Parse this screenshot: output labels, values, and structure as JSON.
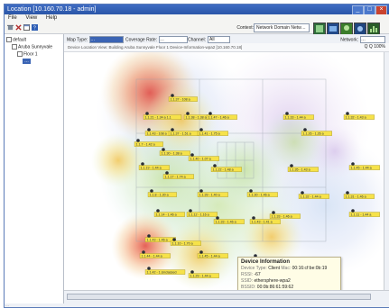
{
  "window": {
    "title": "Location [10.160.70.18 - admin]",
    "controls": [
      "_",
      "□",
      "×"
    ]
  },
  "menu": [
    "File",
    "View",
    "Help"
  ],
  "toolbar": {
    "context_label": "Context:",
    "context_value": "Network Domain Netw…",
    "icons": [
      "delete-icon",
      "refresh-icon",
      "help-icon"
    ],
    "right_icons": [
      "topology-icon",
      "map-icon",
      "users-icon",
      "settings-icon",
      "chart-icon"
    ]
  },
  "tree": {
    "items": [
      {
        "label": "default",
        "level": 0
      },
      {
        "label": "Aruba Sunnyvale",
        "level": 1
      },
      {
        "label": "Floor 1",
        "level": 2
      },
      {
        "label": "…",
        "level": 3,
        "selected": true
      }
    ]
  },
  "options": {
    "map_type_label": "Map Type:",
    "map_type_value": "…",
    "coverage_label": "Coverage Rate:",
    "coverage_value": "…",
    "channel_label": "Channel:",
    "channel_value": "All",
    "network_label": "Network:",
    "network_value": "…"
  },
  "breadcrumb": "Device Location View: Building Aruba Sunnyvale Floor 1 Device-Information-wpa2 [10.160.70.18]",
  "zoom": "Q Q 100%",
  "status": "…",
  "popup": {
    "title": "Device Information",
    "device_type_label": "Device Type:",
    "device_type_value": "Client",
    "mac_label": "Mac:",
    "mac_value": "00:16:cf:be:0b:19",
    "rssi_label": "RSSI:",
    "rssi_value": "-67",
    "ssid_label": "SSID:",
    "ssid_value": "ethersphere-wpa2",
    "bssid_label": "BSSID:",
    "bssid_value": "00:0b:86:61:59:62"
  },
  "devices": [
    {
      "label": "1.1.37 - 108 a"
    },
    {
      "label": "1.1.21 - 1.34 a 1.1"
    },
    {
      "label": "1.1.38 - 1.38 a"
    },
    {
      "label": "1.1.47 - 1.46 a"
    },
    {
      "label": "1.1.33 - 1.44 a"
    },
    {
      "label": "1.1.32 - 1.43 a"
    },
    {
      "label": "1.1.43 - 108 a"
    },
    {
      "label": "1.1.37 - 1.51 a"
    },
    {
      "label": "1.1.41 - 1.75 a"
    },
    {
      "label": "1.1.26 - 1.26 a"
    },
    {
      "label": "1.1.7 - 1.42 a"
    },
    {
      "label": "1.1.30 - 1.38 a"
    },
    {
      "label": "1.1.40 - 1.07 a"
    },
    {
      "label": "1.1.19 - 1.44 a"
    },
    {
      "label": "1.1.17 - 1.74 a"
    },
    {
      "label": "1.1.22 - 1.48 a"
    },
    {
      "label": "1.1.35 - 1.43 a"
    },
    {
      "label": "1.1.45 - 1.44 a"
    },
    {
      "label": "1.1.8 - 1.30 a"
    },
    {
      "label": "1.1.39 - 1.40 a"
    },
    {
      "label": "1.1.30 - 1.46 a"
    },
    {
      "label": "1.1.32 - 1.44 a"
    },
    {
      "label": "1.1.31 - 1.46 a"
    },
    {
      "label": "1.1.14 - 1.46 a"
    },
    {
      "label": "1.1.12 - 1.16 a"
    },
    {
      "label": "1.1.33 - 1.46 a"
    },
    {
      "label": "1.1.43 - 1.41 a"
    },
    {
      "label": "1.1.33 - 1.46 a"
    },
    {
      "label": "1.1.11 - 1.44 a"
    },
    {
      "label": "1.1.43 - 1.46 a"
    },
    {
      "label": "1.1.10 - 1.70 a"
    },
    {
      "label": "1.1.44 - 1.44 a"
    },
    {
      "label": "1.1.45 - 1.44 a"
    },
    {
      "label": "1.1.17 - 1.14 a"
    },
    {
      "label": "1.1.42 - 1.Unclassed"
    },
    {
      "label": "1.1.29 - 1.44 a"
    }
  ]
}
